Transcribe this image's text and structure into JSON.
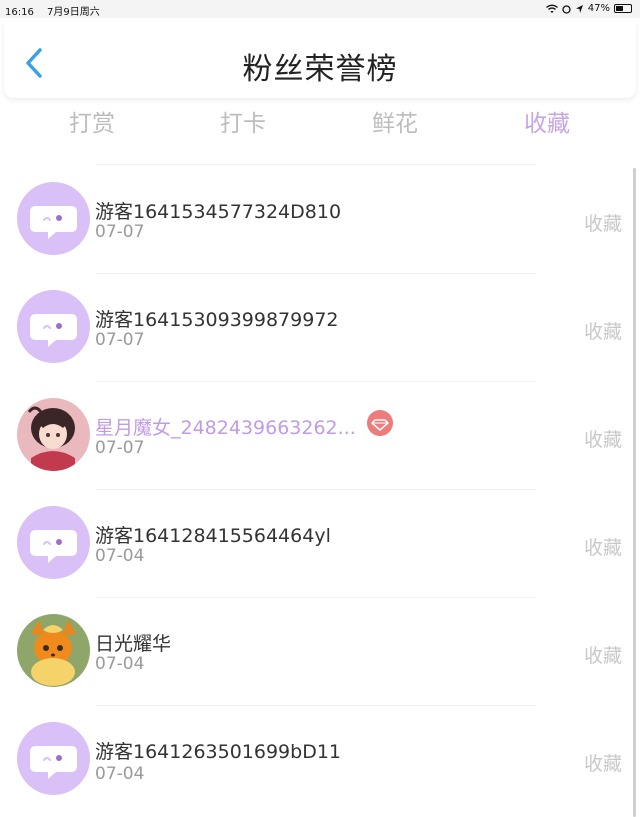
{
  "status": {
    "time": "16:16",
    "date": "7月9日周六",
    "battery": "47%"
  },
  "header": {
    "title": "粉丝荣誉榜"
  },
  "tabs": [
    {
      "label": "打赏",
      "active": false
    },
    {
      "label": "打卡",
      "active": false
    },
    {
      "label": "鲜花",
      "active": false
    },
    {
      "label": "收藏",
      "active": true
    }
  ],
  "rows": [
    {
      "name": "游客1641534577324D810",
      "date": "07-07",
      "type": "收藏",
      "avatar": "default-chat-avatar"
    },
    {
      "name": "游客16415309399879972",
      "date": "07-07",
      "type": "收藏",
      "avatar": "default-chat-avatar"
    },
    {
      "name": "星月魔女_2482439663262...",
      "date": "07-07",
      "type": "收藏",
      "avatar": "anime-girl-avatar",
      "vip": true
    },
    {
      "name": "游客164128415564464yl",
      "date": "07-04",
      "type": "收藏",
      "avatar": "default-chat-avatar"
    },
    {
      "name": "日光耀华",
      "date": "07-04",
      "type": "收藏",
      "avatar": "flareon-avatar"
    },
    {
      "name": "游客1641263501699bD11",
      "date": "07-04",
      "type": "收藏",
      "avatar": "default-chat-avatar"
    }
  ],
  "colors": {
    "accent": "#c7a6e6",
    "avatar_bg": "#d9c0f6",
    "back_arrow": "#3aa0e8",
    "vip_badge": "#ef7c7c"
  }
}
